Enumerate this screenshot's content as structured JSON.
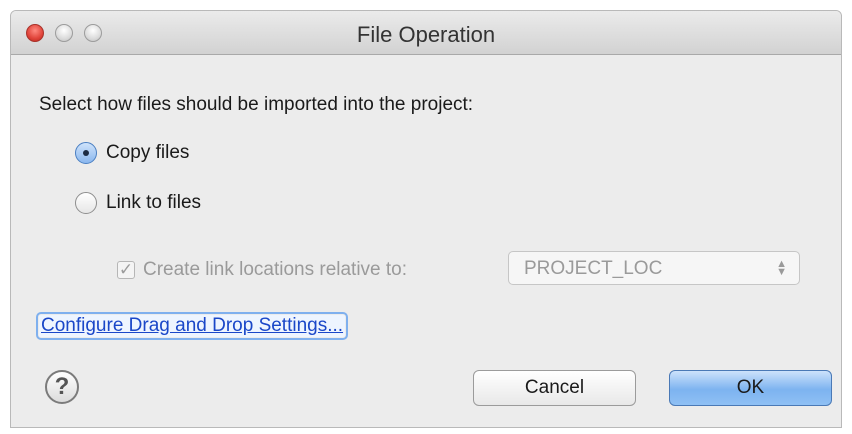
{
  "window": {
    "title": "File Operation"
  },
  "prompt": "Select how files should be imported into the project:",
  "options": [
    {
      "label": "Copy files",
      "selected": true
    },
    {
      "label": "Link to files",
      "selected": false
    }
  ],
  "relative": {
    "label": "Create link locations relative to:",
    "checked": true,
    "enabled": false,
    "select_value": "PROJECT_LOC"
  },
  "link_text": "Configure Drag and Drop Settings...",
  "buttons": {
    "help": "?",
    "cancel": "Cancel",
    "ok": "OK"
  },
  "colors": {
    "accent": "#7db3f0",
    "link": "#1a47c8",
    "close": "#e0443a"
  }
}
